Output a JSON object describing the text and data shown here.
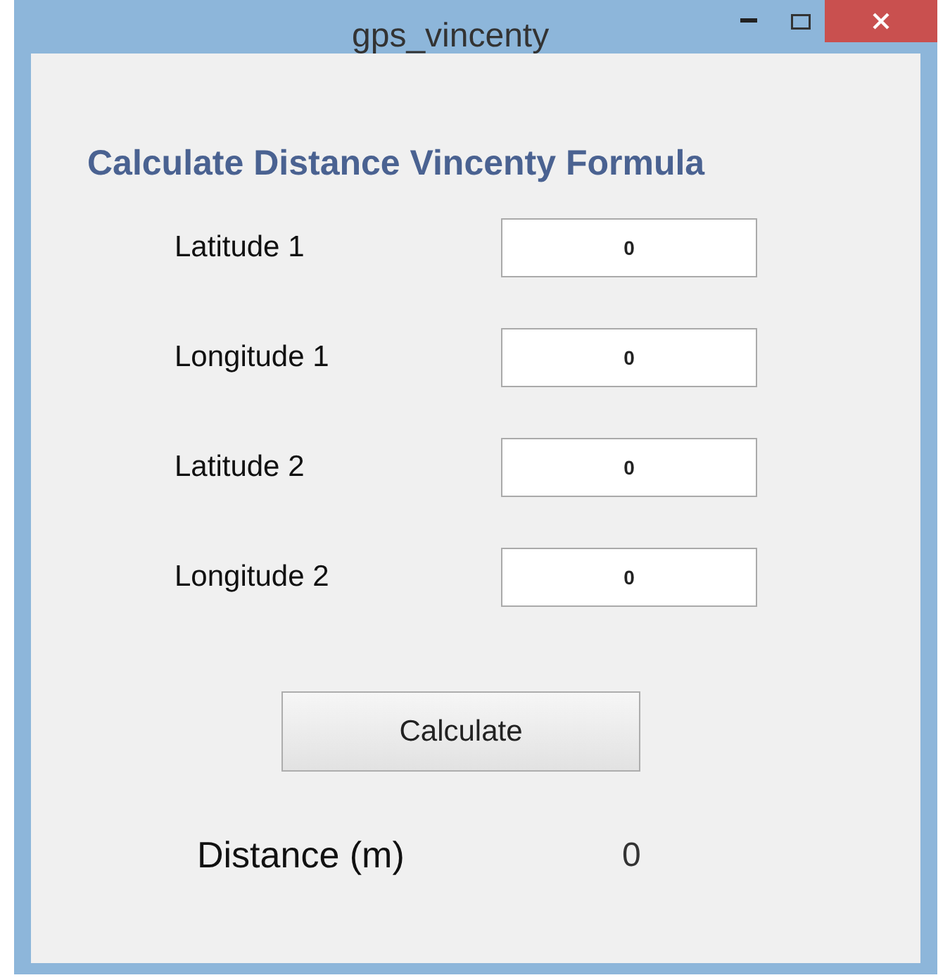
{
  "window": {
    "title": "gps_vincenty"
  },
  "heading": "Calculate Distance Vincenty Formula",
  "fields": [
    {
      "label": "Latitude 1",
      "value": "0"
    },
    {
      "label": "Longitude 1",
      "value": "0"
    },
    {
      "label": "Latitude 2",
      "value": "0"
    },
    {
      "label": "Longitude 2",
      "value": "0"
    }
  ],
  "button": "Calculate",
  "result": {
    "label": "Distance (m)",
    "value": "0"
  }
}
